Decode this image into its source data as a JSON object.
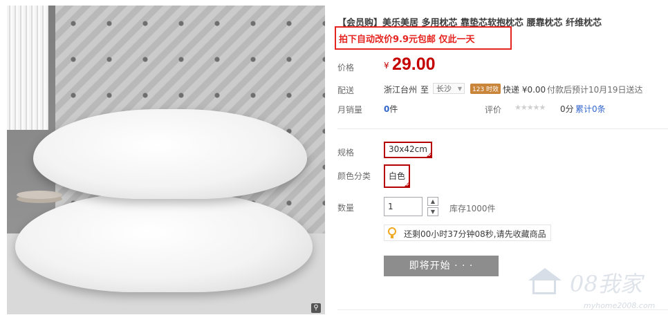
{
  "product": {
    "title": "【会员购】美乐美居 多用枕芯 靠垫芯软抱枕芯 腰靠枕芯 纤维枕芯",
    "promo": "拍下自动改价9.9元包邮 仅此一天"
  },
  "price": {
    "label": "价格",
    "currency": "¥",
    "value": "29.00"
  },
  "shipping": {
    "label": "配送",
    "from": "浙江台州",
    "to_word": "至",
    "city": "长沙",
    "timely_badge": "123 时效",
    "method": "快递 ¥0.00",
    "eta": "付款后预计10月19日送达"
  },
  "sales": {
    "label": "月销量",
    "count": "0",
    "unit": "件",
    "rating_label": "评价",
    "stars": "★★★★★",
    "score": "0分",
    "cumulative": "累计0条"
  },
  "options": {
    "size_label": "规格",
    "size_value": "30x42cm",
    "color_label": "颜色分类",
    "color_value": "白色"
  },
  "quantity": {
    "label": "数量",
    "value": "1",
    "up": "▲",
    "down": "▼",
    "stock": "库存1000件"
  },
  "countdown_tip": "还剩00小时37分钟08秒,请先收藏商品",
  "buy_button": "即将开始 · · ·",
  "watermark": {
    "brand": "08我家",
    "url": "myhome2008.com"
  },
  "colors": {
    "price": "#c40000",
    "promo": "#e5231f",
    "button": "#8d8d8d"
  }
}
